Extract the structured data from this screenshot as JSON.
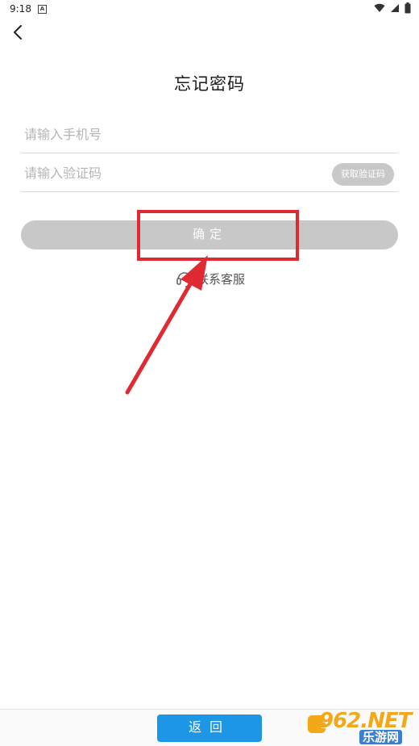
{
  "status": {
    "time": "9:18",
    "badge": "A"
  },
  "header": {
    "title": "忘记密码"
  },
  "form": {
    "phone_placeholder": "请输入手机号",
    "code_placeholder": "请输入验证码",
    "get_code_label": "获取验证码",
    "confirm_label": "确定"
  },
  "service": {
    "label": "联系客服"
  },
  "bottom": {
    "back_label": "返回"
  },
  "watermark": {
    "top": "962.NET",
    "bottom": "乐游网"
  },
  "colors": {
    "accent": "#1e96e6",
    "disabled": "#c8c8c8",
    "highlight": "#e02a33"
  }
}
